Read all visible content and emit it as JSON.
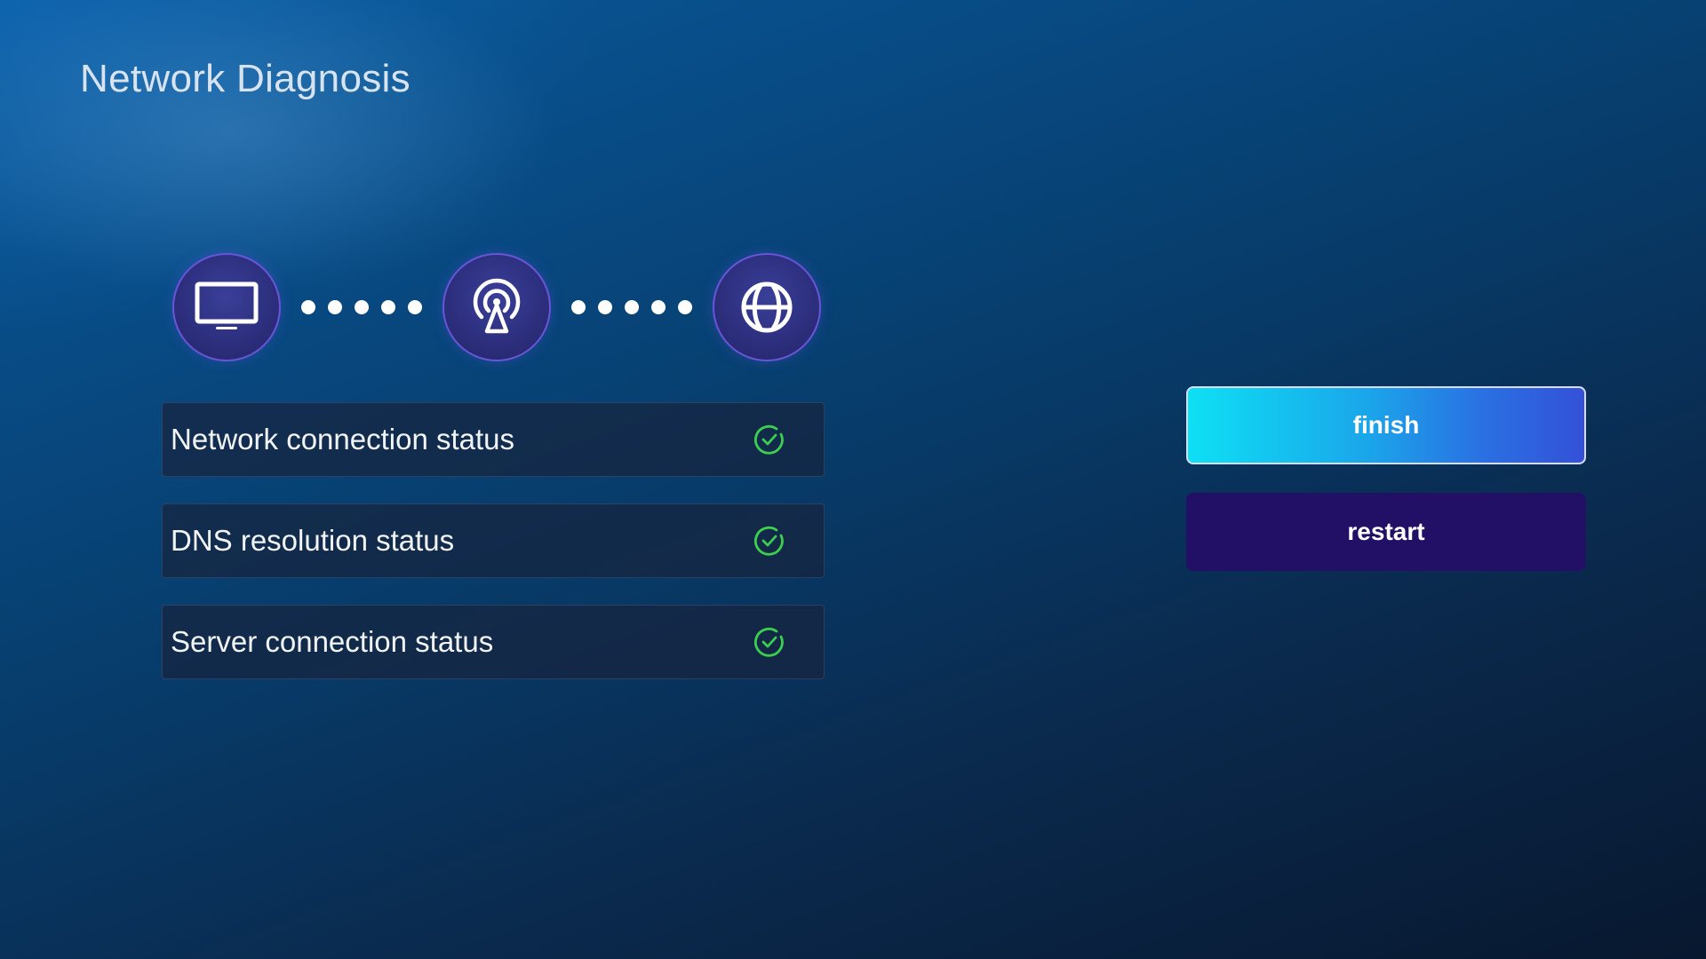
{
  "page": {
    "title": "Network Diagnosis"
  },
  "diagram": {
    "nodes": [
      {
        "icon": "tv-icon"
      },
      {
        "icon": "router-signal-icon"
      },
      {
        "icon": "globe-icon"
      }
    ],
    "connector_dots": 5
  },
  "status_items": [
    {
      "label": "Network connection status",
      "state": "success",
      "icon": "check-circle-icon"
    },
    {
      "label": "DNS resolution status",
      "state": "success",
      "icon": "check-circle-icon"
    },
    {
      "label": "Server connection status",
      "state": "success",
      "icon": "check-circle-icon"
    }
  ],
  "buttons": {
    "finish_label": "finish",
    "restart_label": "restart"
  },
  "colors": {
    "success": "#3ccf4e",
    "finish_gradient_start": "#0ee0f4",
    "finish_gradient_end": "#3451d8",
    "restart_bg": "#221066",
    "node_border": "#6a55d8"
  }
}
